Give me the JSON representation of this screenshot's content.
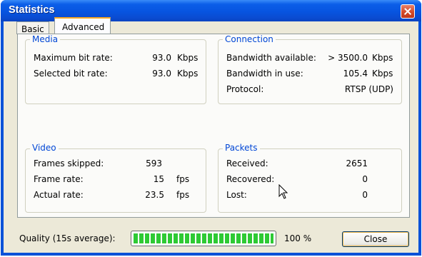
{
  "window": {
    "title": "Statistics"
  },
  "tabs": [
    {
      "label": "Basic"
    },
    {
      "label": "Advanced"
    }
  ],
  "media": {
    "title": "Media",
    "rows": [
      {
        "label": "Maximum bit rate:",
        "value": "93.0",
        "unit": "Kbps"
      },
      {
        "label": "Selected bit rate:",
        "value": "93.0",
        "unit": "Kbps"
      }
    ]
  },
  "connection": {
    "title": "Connection",
    "rows": [
      {
        "label": "Bandwidth available:",
        "value": "> 3500.0",
        "unit": "Kbps"
      },
      {
        "label": "Bandwidth in use:",
        "value": "105.4",
        "unit": "Kbps"
      },
      {
        "label": "Protocol:",
        "value": "RTSP (UDP)"
      }
    ]
  },
  "video": {
    "title": "Video",
    "rows": [
      {
        "label": "Frames skipped:",
        "value": "593"
      },
      {
        "label": "Frame rate:",
        "value": "15",
        "unit": "fps"
      },
      {
        "label": "Actual rate:",
        "value": "23.5",
        "unit": "fps"
      }
    ]
  },
  "packets": {
    "title": "Packets",
    "rows": [
      {
        "label": "Received:",
        "value": "2651"
      },
      {
        "label": "Recovered:",
        "value": "0"
      },
      {
        "label": "Lost:",
        "value": "0"
      }
    ]
  },
  "quality": {
    "label": "Quality (15s average):",
    "percent_text": "100 %",
    "level": 1.0
  },
  "buttons": {
    "close_label": "Close"
  },
  "colors": {
    "titlebar": "#0754e0",
    "group_title": "#0046d5",
    "progress": "#2eca34",
    "close_button": "#d44a28"
  }
}
